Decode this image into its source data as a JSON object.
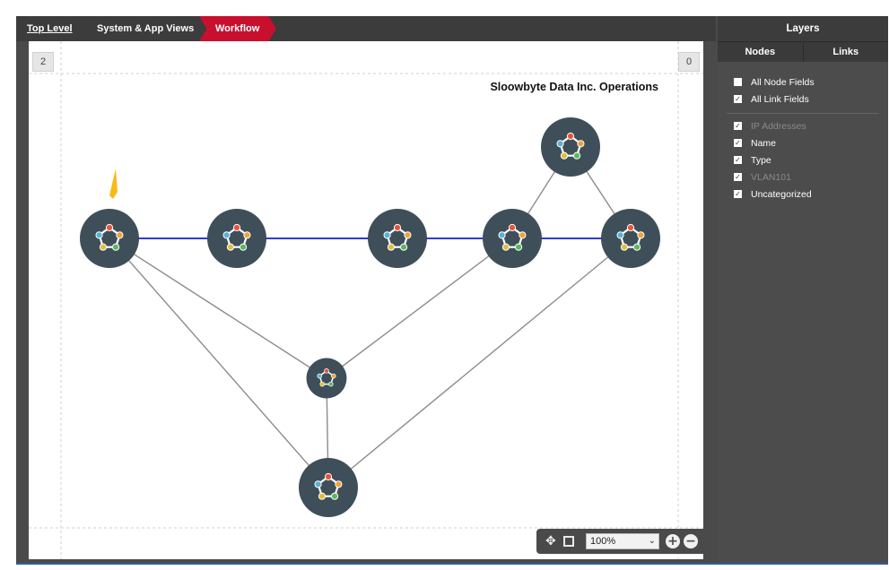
{
  "breadcrumb": {
    "items": [
      "Top Level",
      "System & App Views",
      "Workflow"
    ]
  },
  "canvas": {
    "title": "Sloowbyte Data Inc. Operations",
    "left_badge": "2",
    "right_badge": "0",
    "colors": {
      "node_fill": "#3f4f59",
      "node_ring": "#ffffff",
      "vlan_link": "#2f3bd4",
      "other_link": "#8c8c8c",
      "alert_flag": "#f6bc16",
      "node_dot_colors": [
        "#e8553a",
        "#f0a23b",
        "#5cb85c",
        "#e0c03b",
        "#5ab0d8"
      ]
    }
  },
  "zoom_toolbar": {
    "pan_icon": "✥",
    "fit_icon": "fit-to-screen-icon",
    "zoom_value": "100%",
    "chevron": "⌄",
    "zoom_in": "+",
    "zoom_out": "−"
  },
  "layers_panel": {
    "title": "Layers",
    "tabs": [
      "Nodes",
      "Links"
    ],
    "checkboxes": [
      {
        "label": "All Node Fields",
        "checked": false,
        "dim": false
      },
      {
        "label": "All Link Fields",
        "checked": true,
        "dim": false
      },
      {
        "label": "IP Addresses",
        "checked": true,
        "dim": true
      },
      {
        "label": "Name",
        "checked": true,
        "dim": false
      },
      {
        "label": "Type",
        "checked": true,
        "dim": false
      },
      {
        "label": "VLAN101",
        "checked": true,
        "dim": true
      },
      {
        "label": "Uncategorized",
        "checked": true,
        "dim": false
      }
    ]
  }
}
